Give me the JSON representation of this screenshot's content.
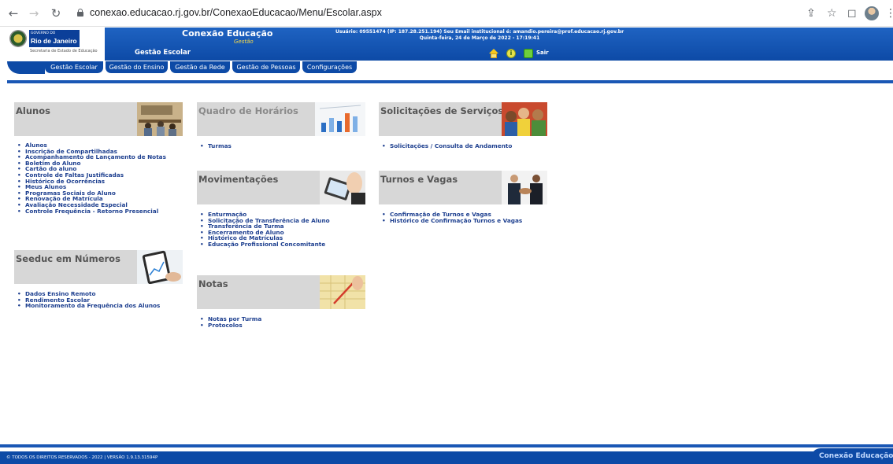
{
  "browser": {
    "url": "conexao.educacao.rj.gov.br/ConexaoEducacao/Menu/Escolar.aspx"
  },
  "header": {
    "logo_small": "GOVERNO DO",
    "logo_rio": "Rio de Janeiro",
    "logo_secretaria": "Secretaria de Estado de Educação",
    "app_title": "Conexão Educação",
    "app_subtitle": "Gestão",
    "module": "Gestão Escolar",
    "user_line1": "Usuário: 09551474 (IP: 187.28.251.194) Seu Email institucional é: amandio.pereira@prof.educacao.rj.gov.br",
    "user_line2": "Quinta-feira, 24 de Março de 2022 - 17:19:41",
    "exit_label": "Sair"
  },
  "tabs": [
    {
      "label": "Gestão Escolar"
    },
    {
      "label": "Gestão do Ensino"
    },
    {
      "label": "Gestão da Rede"
    },
    {
      "label": "Gestão de Pessoas"
    },
    {
      "label": "Configurações"
    }
  ],
  "panels": {
    "alunos": {
      "title": "Alunos",
      "items": [
        "Alunos",
        "Inscrição de Compartilhadas",
        "Acompanhamento de Lançamento de Notas",
        "Boletim do Aluno",
        "Cartão do aluno",
        "Controle de Faltas Justificadas",
        "Histórico de Ocorrências",
        "Meus Alunos",
        "Programas Sociais do Aluno",
        "Renovação de Matrícula",
        "Avaliação Necessidade Especial",
        "Controle Frequência - Retorno Presencial"
      ]
    },
    "seeduc": {
      "title": "Seeduc em Números",
      "items": [
        "Dados Ensino Remoto",
        "Rendimento Escolar",
        "Monitoramento da Frequência dos Alunos"
      ]
    },
    "quadro": {
      "title": "Quadro de Horários",
      "items": [
        "Turmas"
      ]
    },
    "movimentacoes": {
      "title": "Movimentações",
      "items": [
        "Enturmação",
        "Solicitação de Transferência de Aluno",
        "Transferência de Turma",
        "Encerramento de Aluno",
        "Histórico de Matrículas",
        "Educação Profissional Concomitante"
      ]
    },
    "notas": {
      "title": "Notas",
      "items": [
        "Notas por Turma",
        "Protocolos"
      ]
    },
    "solicitacoes": {
      "title": "Solicitações de Serviços",
      "items": [
        "Solicitações / Consulta de Andamento"
      ]
    },
    "turnos": {
      "title": "Turnos e Vagas",
      "items": [
        "Confirmação de Turnos e Vagas",
        "Histórico de Confirmação Turnos e Vagas"
      ]
    }
  },
  "footer": {
    "copyright": "© TODOS OS DIREITOS RESERVADOS - 2022 | VERSÃO 1.9.13.31594P",
    "brand": "Conexão Educação"
  },
  "colors": {
    "header_blue": "#0d4aa6",
    "link_blue": "#1d3f8f",
    "panel_gray": "#d7d7d7"
  }
}
